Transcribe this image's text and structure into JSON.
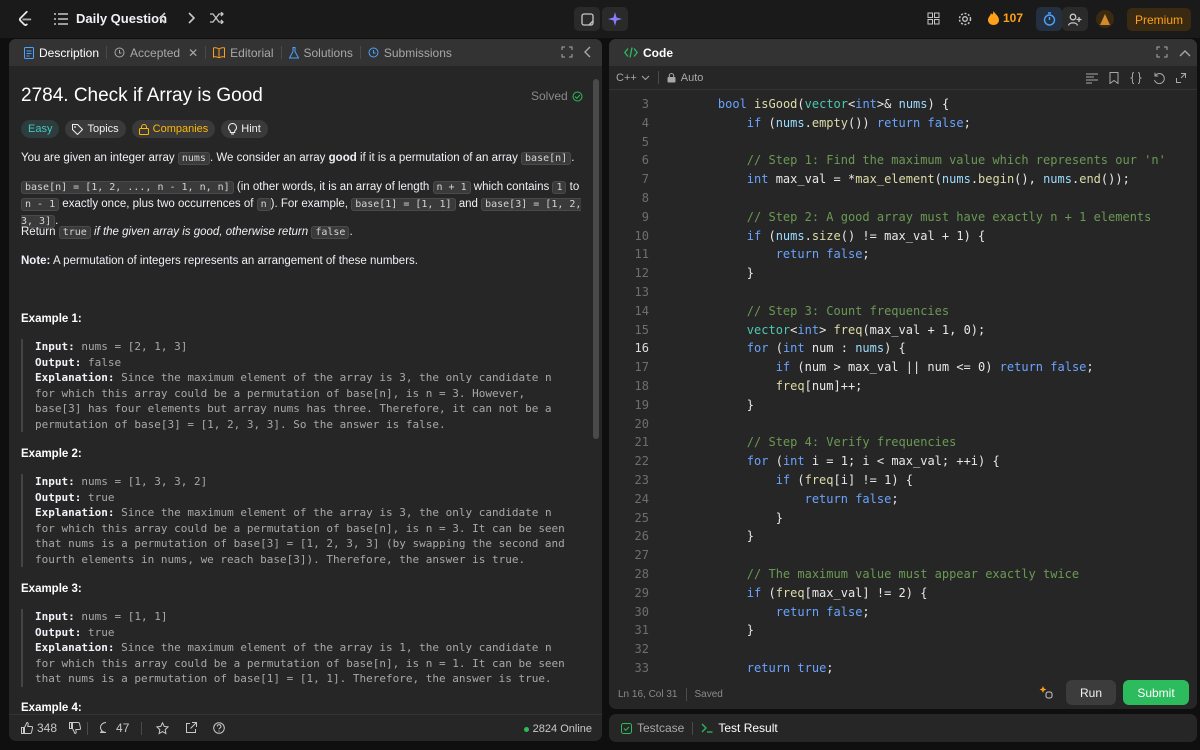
{
  "topbar": {
    "title": "Daily Question",
    "streak": "107",
    "premium": "Premium"
  },
  "left_tabs": [
    "Description",
    "Accepted",
    "Editorial",
    "Solutions",
    "Submissions"
  ],
  "problem": {
    "title": "2784. Check if Array is Good",
    "status": "Solved",
    "tags": [
      "Easy",
      "Topics",
      "Companies",
      "Hint"
    ],
    "p1a": "You are given an integer array ",
    "p1code": "nums",
    "p1b": ". We consider an array ",
    "p1bold": "good",
    "p1c": " if it is a permutation of an array ",
    "p1code2": "base[n]",
    "p1d": ".",
    "p2code1": "base[n] = [1, 2, ..., n - 1, n, n]",
    "p2a": " (in other words, it is an array of length ",
    "p2code2": "n + 1",
    "p2b": " which contains ",
    "p2code3": "1",
    "p2c": " to ",
    "p2code4": "n - 1",
    "p2d": " exactly once, plus two occurrences of ",
    "p2code5": "n",
    "p2e": "). For example, ",
    "p2code6": "base[1] = [1, 1]",
    "p2f": " and ",
    "p2code7": "base[3] = [1, 2, 3, 3]",
    "p2g": ".",
    "p3a": "Return ",
    "p3code1": "true",
    "p3b": " if the given array is good, otherwise return ",
    "p3code2": "false",
    "p3c": ".",
    "note_label": "Note:",
    "note_text": " A permutation of integers represents an arrangement of these numbers.",
    "examples": [
      {
        "heading": "Example 1:",
        "input_label": "Input:",
        "input": " nums = [2, 1, 3]",
        "output_label": "Output:",
        "output": " false",
        "expl_label": "Explanation:",
        "expl": " Since the maximum element of the array is 3, the only candidate n for which this array could be a permutation of base[n], is n = 3. However, base[3] has four elements but array nums has three. Therefore, it can not be a permutation of base[3] = [1, 2, 3, 3]. So the answer is false."
      },
      {
        "heading": "Example 2:",
        "input_label": "Input:",
        "input": " nums = [1, 3, 3, 2]",
        "output_label": "Output:",
        "output": " true",
        "expl_label": "Explanation:",
        "expl": " Since the maximum element of the array is 3, the only candidate n for which this array could be a permutation of base[n], is n = 3. It can be seen that nums is a permutation of base[3] = [1, 2, 3, 3] (by swapping the second and fourth elements in nums, we reach base[3]). Therefore, the answer is true."
      },
      {
        "heading": "Example 3:",
        "input_label": "Input:",
        "input": " nums = [1, 1]",
        "output_label": "Output:",
        "output": " true",
        "expl_label": "Explanation:",
        "expl": " Since the maximum element of the array is 1, the only candidate n for which this array could be a permutation of base[n], is n = 1. It can be seen that nums is a permutation of base[1] = [1, 1]. Therefore, the answer is true."
      },
      {
        "heading": "Example 4:"
      }
    ]
  },
  "footer": {
    "likes": "348",
    "comments": "47",
    "online": "2824 Online"
  },
  "code_panel": {
    "title": "Code",
    "language": "C++",
    "mode": "Auto",
    "status_pos": "Ln 16, Col 31",
    "status_saved": "Saved",
    "run": "Run",
    "submit": "Submit"
  },
  "code_lines": [
    {
      "n": "3",
      "t": "    bool isGood(vector<int>& nums) {"
    },
    {
      "n": "4",
      "t": "        if (nums.empty()) return false;"
    },
    {
      "n": "5",
      "t": ""
    },
    {
      "n": "6",
      "t": "        // Step 1: Find the maximum value which represents our 'n'"
    },
    {
      "n": "7",
      "t": "        int max_val = *max_element(nums.begin(), nums.end());"
    },
    {
      "n": "8",
      "t": ""
    },
    {
      "n": "9",
      "t": "        // Step 2: A good array must have exactly n + 1 elements"
    },
    {
      "n": "10",
      "t": "        if (nums.size() != max_val + 1) {"
    },
    {
      "n": "11",
      "t": "            return false;"
    },
    {
      "n": "12",
      "t": "        }"
    },
    {
      "n": "13",
      "t": ""
    },
    {
      "n": "14",
      "t": "        // Step 3: Count frequencies"
    },
    {
      "n": "15",
      "t": "        vector<int> freq(max_val + 1, 0);"
    },
    {
      "n": "16",
      "t": "        for (int num : nums) {"
    },
    {
      "n": "17",
      "t": "            if (num > max_val || num <= 0) return false;"
    },
    {
      "n": "18",
      "t": "            freq[num]++;"
    },
    {
      "n": "19",
      "t": "        }"
    },
    {
      "n": "20",
      "t": ""
    },
    {
      "n": "21",
      "t": "        // Step 4: Verify frequencies"
    },
    {
      "n": "22",
      "t": "        for (int i = 1; i < max_val; ++i) {"
    },
    {
      "n": "23",
      "t": "            if (freq[i] != 1) {"
    },
    {
      "n": "24",
      "t": "                return false;"
    },
    {
      "n": "25",
      "t": "            }"
    },
    {
      "n": "26",
      "t": "        }"
    },
    {
      "n": "27",
      "t": ""
    },
    {
      "n": "28",
      "t": "        // The maximum value must appear exactly twice"
    },
    {
      "n": "29",
      "t": "        if (freq[max_val] != 2) {"
    },
    {
      "n": "30",
      "t": "            return false;"
    },
    {
      "n": "31",
      "t": "        }"
    },
    {
      "n": "32",
      "t": ""
    },
    {
      "n": "33",
      "t": "        return true;"
    }
  ],
  "current_line": "16",
  "result_tabs": [
    "Testcase",
    "Test Result"
  ],
  "colors": {
    "accent": "#ffa116",
    "green": "#2cbb5d",
    "easy": "#46c6c2"
  }
}
